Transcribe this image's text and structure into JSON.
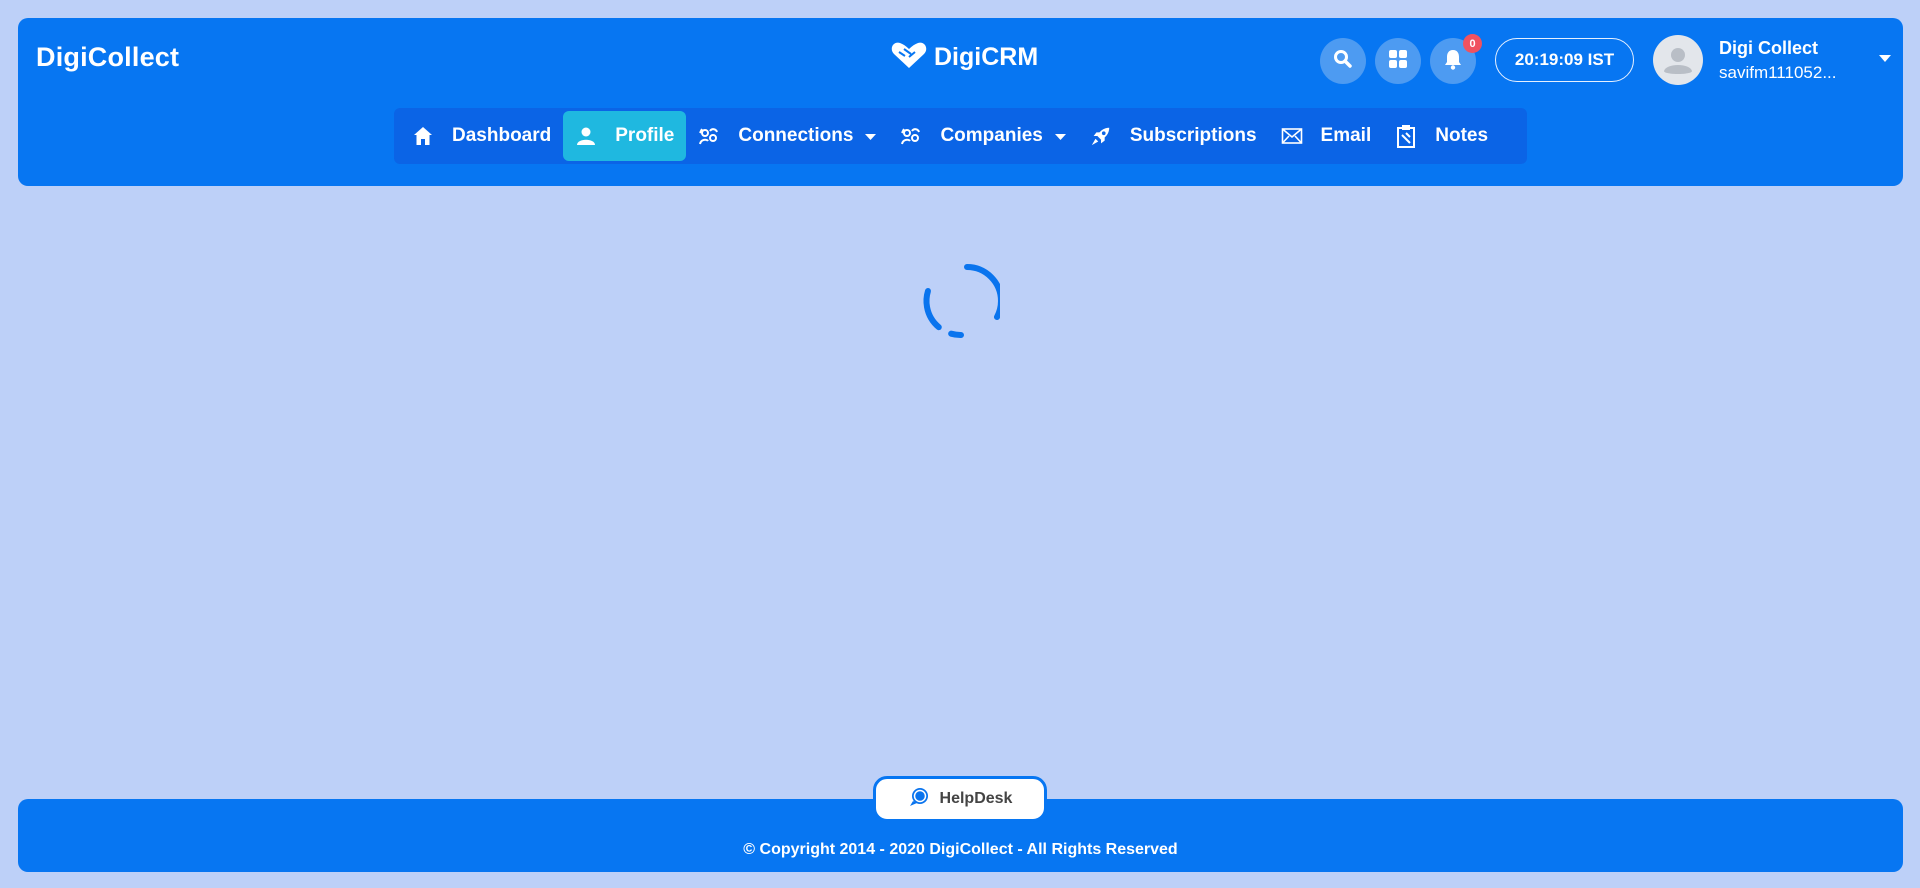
{
  "header": {
    "brand": "DigiCollect",
    "center_logo": "DigiCRM",
    "icons": [
      "search-icon",
      "apps-grid-icon",
      "bell-icon"
    ],
    "notifications_count": "0",
    "clock": "20:19:09 IST",
    "user": {
      "name": "Digi Collect",
      "sub": "savifm111052..."
    }
  },
  "nav": {
    "items": [
      {
        "label": "Dashboard",
        "icon": "home-icon"
      },
      {
        "label": "Profile",
        "icon": "user-icon",
        "active": true
      },
      {
        "label": "Connections",
        "icon": "connections-icon",
        "dropdown": true
      },
      {
        "label": "Companies",
        "icon": "companies-icon",
        "dropdown": true
      },
      {
        "label": "Subscriptions",
        "icon": "rocket-icon"
      },
      {
        "label": "Email",
        "icon": "envelope-icon"
      },
      {
        "label": "Notes",
        "icon": "clipboard-icon"
      }
    ]
  },
  "helpdesk": {
    "label": "HelpDesk"
  },
  "footer": {
    "copyright": "© Copyright 2014 - 2020 DigiCollect - All Rights Reserved"
  },
  "colors": {
    "background": "#bdd0f8",
    "primary": "#0776f2",
    "nav_bg": "#0b64e6",
    "active_tab": "#1fb8e0",
    "badge": "#f0525f"
  }
}
